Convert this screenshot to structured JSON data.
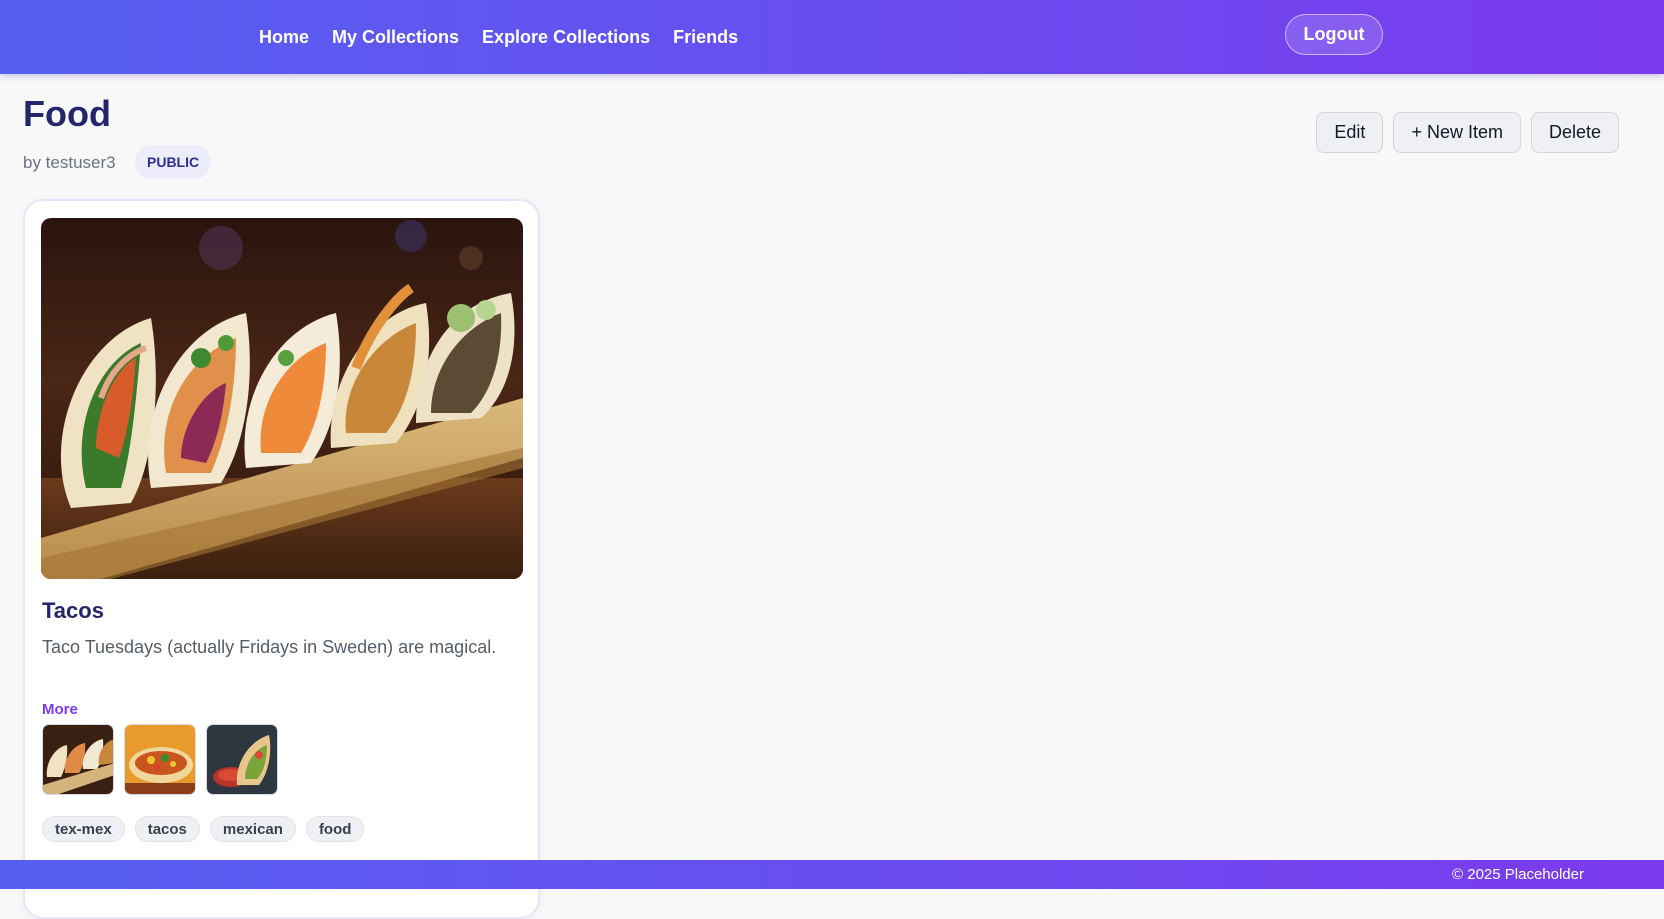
{
  "nav": {
    "items": [
      {
        "label": "Home"
      },
      {
        "label": "My Collections"
      },
      {
        "label": "Explore Collections"
      },
      {
        "label": "Friends"
      }
    ],
    "logout_label": "Logout"
  },
  "collection": {
    "title": "Food",
    "byline": "by testuser3",
    "visibility": "PUBLIC"
  },
  "actions": {
    "edit_label": "Edit",
    "new_item_label": "+ New Item",
    "delete_label": "Delete"
  },
  "item": {
    "title": "Tacos",
    "description": "Taco Tuesdays (actually Fridays in Sweden) are magical.",
    "more_label": "More",
    "tags": [
      "tex-mex",
      "tacos",
      "mexican",
      "food"
    ]
  },
  "footer": {
    "copyright": "© 2025 Placeholder"
  },
  "colors": {
    "brand_start": "#5560f0",
    "brand_end": "#7c3aed",
    "title": "#23266b",
    "accent": "#7c3aed"
  }
}
